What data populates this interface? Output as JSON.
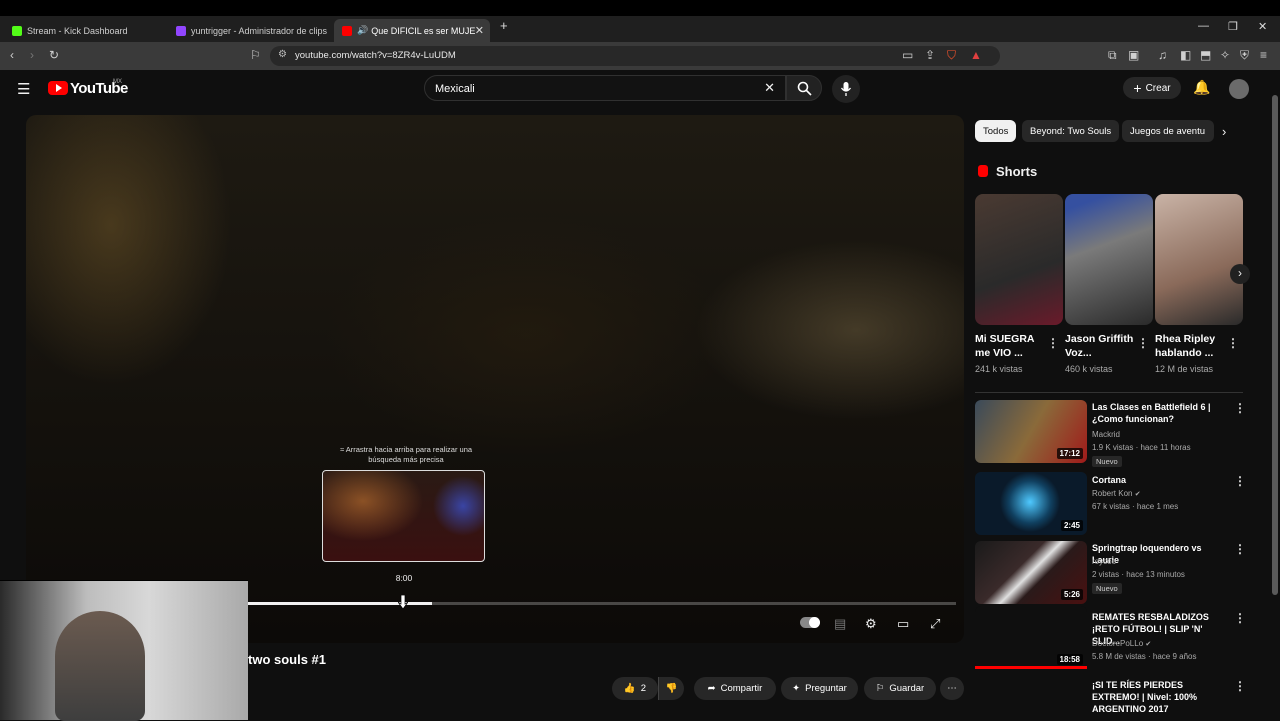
{
  "browser": {
    "tabs": [
      {
        "title": "Stream - Kick Dashboard",
        "color": "#53fc18"
      },
      {
        "title": "yuntrigger - Administrador de clips",
        "color": "#9146ff"
      },
      {
        "title": "Que DIFICIL es ser MUJER / B",
        "color": "#ff0000",
        "active": true
      }
    ],
    "new_tab": "+",
    "url": "youtube.com/watch?v=8ZR4v-LuUDM"
  },
  "header": {
    "brand": "YouTube",
    "region": "MX",
    "search_value": "Mexicali",
    "create_label": "Crear"
  },
  "player": {
    "hint": "Arrastra hacia arriba para realizar una búsqueda más precisa",
    "preview_time": "8:00",
    "progress": 0.26
  },
  "video": {
    "title": "two souls #1",
    "likes": "2",
    "share": "Compartir",
    "ask": "Preguntar",
    "save": "Guardar"
  },
  "sidebar": {
    "chips": [
      "Todos",
      "Beyond: Two Souls",
      "Juegos de aventu"
    ],
    "shorts_title": "Shorts",
    "shorts": [
      {
        "title": "Mi SUEGRA me VIO ...",
        "views": "241 k vistas"
      },
      {
        "title": "Jason Griffith Voz...",
        "views": "460 k vistas"
      },
      {
        "title": "Rhea Ripley hablando ...",
        "views": "12 M de vistas"
      }
    ],
    "recommended": [
      {
        "title": "Las Clases en Battlefield 6 | ¿Como funcionan?",
        "channel": "Mackrid",
        "meta": "1.9 K vistas · hace 11 horas",
        "badge": "Nuevo",
        "duration": "17:12"
      },
      {
        "title": "Cortana",
        "channel": "Robert Kon",
        "meta": "67 k vistas · hace 1 mes",
        "badge": "",
        "duration": "2:45"
      },
      {
        "title": "Springtrap loquendero vs Laurie",
        "channel": "reycoo",
        "meta": "2 vistas · hace 13 minutos",
        "badge": "Nuevo",
        "duration": "5:26"
      },
      {
        "title": "REMATES RESBALADIZOS ¡RETO FÚTBOL! | SLIP 'N' SLID...",
        "channel": "DoctorePoLLo",
        "meta": "5.8 M de vistas · hace 9 años",
        "badge": "",
        "duration": "18:58"
      },
      {
        "title": "¡SI TE RÍES PIERDES EXTREMO! | Nivel: 100% ARGENTINO 2017",
        "channel": "",
        "meta": "",
        "badge": "",
        "duration": ""
      }
    ]
  }
}
